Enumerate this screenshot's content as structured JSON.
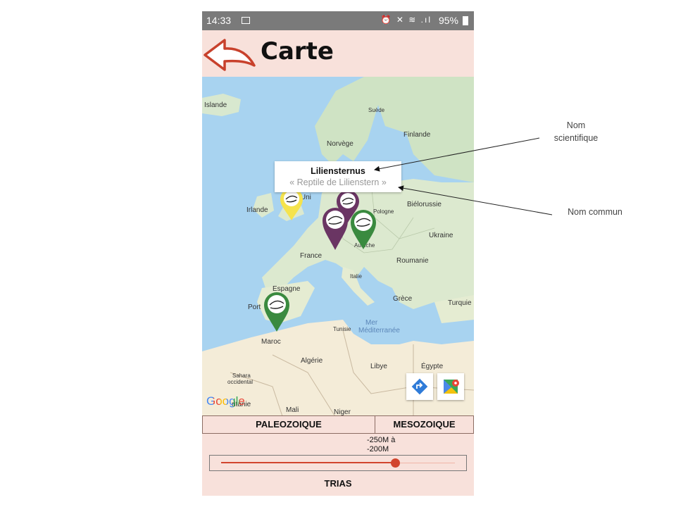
{
  "status_bar": {
    "time": "14:33",
    "right_icons": "⏰ ✕ ≋ .ıl",
    "battery": "95%"
  },
  "header": {
    "title": "Carte",
    "back_icon": "back-arrow-icon"
  },
  "map": {
    "labels": {
      "islande": "Islande",
      "suede": "Suède",
      "finlande": "Finlande",
      "norvege": "Norvège",
      "irlande": "Irlande",
      "royaume_uni": "e-Uni",
      "pologne": "Pologne",
      "bielorussie": "Biélorussie",
      "ukraine": "Ukraine",
      "autriche": "Autriche",
      "france": "France",
      "roumanie": "Roumanie",
      "italie": "Italie",
      "espagne": "Espagne",
      "portugal": "Port",
      "grece": "Grèce",
      "turquie": "Turquie",
      "tunisie": "Tunisie",
      "mer": "Mer",
      "mediterranee": "Méditerranée",
      "maroc": "Maroc",
      "algerie": "Algérie",
      "libye": "Libye",
      "egypte": "Égypte",
      "sahara1": "Sahara",
      "sahara2": "occidental",
      "mauritanie": "ritanie",
      "mali": "Mali",
      "niger": "Niger"
    },
    "info_window": {
      "scientific_name": "Liliensternus",
      "common_name": "« Reptile de Lilienstern »"
    },
    "markers": [
      {
        "name": "marker-yellow",
        "color": "#f5e34d"
      },
      {
        "name": "marker-purple-back",
        "color": "#6a3563"
      },
      {
        "name": "marker-purple",
        "color": "#6a3563"
      },
      {
        "name": "marker-green-europe",
        "color": "#3a8a3f"
      },
      {
        "name": "marker-green-spain",
        "color": "#3a8a3f"
      }
    ],
    "attribution": "Google",
    "colors": {
      "sea": "#a8d3f0",
      "land_north": "#cfe3c4",
      "land_south": "#f4ecd8"
    }
  },
  "tabs": [
    {
      "label": "PALEOZOIQUE"
    },
    {
      "label": "MESOZOIQUE"
    }
  ],
  "range": {
    "line1": "-250M à",
    "line2": "-200M"
  },
  "slider": {
    "value_fraction": 0.745,
    "accent": "#d2452e"
  },
  "era": "TRIAS",
  "annotations": {
    "scientific_line1": "Nom",
    "scientific_line2": "scientifique",
    "common": "Nom commun"
  }
}
